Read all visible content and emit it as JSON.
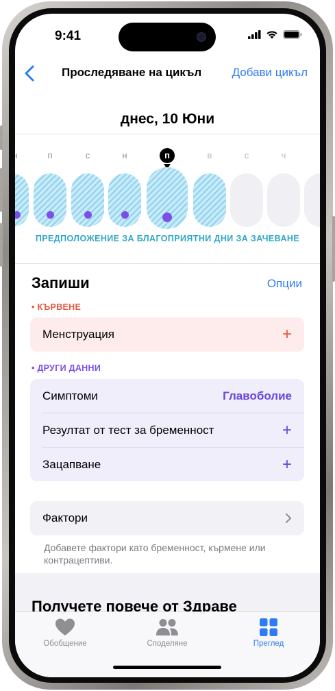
{
  "status_bar": {
    "time": "9:41"
  },
  "nav": {
    "title": "Проследяване на цикъл",
    "action": "Добави цикъл",
    "back_icon": "chevron-left-icon"
  },
  "date_heading": "днес, 10 Юни",
  "week": {
    "letters": [
      "н",
      "п",
      "с",
      "н",
      "п",
      "в",
      "с",
      "ч"
    ],
    "today_letter": "п",
    "fertile_label": "ПРЕДПОЛОЖЕНИЕ ЗА БЛАГОПРИЯТНИ ДНИ ЗА ЗАЧЕВАНЕ"
  },
  "log": {
    "title": "Запиши",
    "options": "Опции",
    "bleeding": {
      "label": "КЪРВЕНЕ",
      "rows": [
        {
          "label": "Менструация"
        }
      ]
    },
    "other": {
      "label": "ДРУГИ ДАННИ",
      "rows": [
        {
          "label": "Симптоми",
          "value": "Главоболие"
        },
        {
          "label": "Резултат от тест за бременност"
        },
        {
          "label": "Зацапване"
        }
      ]
    },
    "factors": {
      "label": "Фактори",
      "note": "Добавете фактори като бременност, кърмене или контрацептиви."
    }
  },
  "promo_title": "Получете повече от Здраве",
  "tabs": [
    {
      "label": "Обобщение",
      "icon": "heart-icon"
    },
    {
      "label": "Споделяне",
      "icon": "people-icon"
    },
    {
      "label": "Преглед",
      "icon": "grid-icon",
      "active": true
    }
  ],
  "colors": {
    "accent_blue": "#2f7bf5",
    "bleeding_red": "#e9563f",
    "other_purple": "#7c4ee8",
    "fertile_teal": "#2fa6c6"
  }
}
